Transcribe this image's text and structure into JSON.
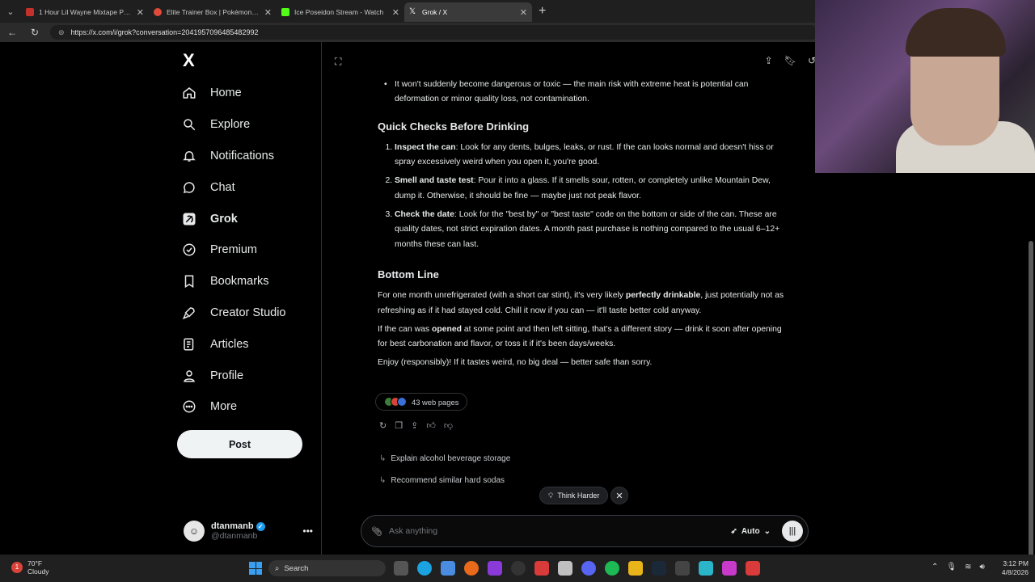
{
  "browser": {
    "tabs": [
      {
        "title": "1 Hour Lil Wayne Mixtape Prime",
        "favicon_color": "#c4302b",
        "active": false
      },
      {
        "title": "Elite Trainer Box | Pokémon Center",
        "favicon_color": "#e04a3a",
        "active": false
      },
      {
        "title": "Ice Poseidon Stream - Watch",
        "favicon_color": "#53fc18",
        "active": false
      },
      {
        "title": "Grok / X",
        "favicon_color": "#ffffff",
        "active": true
      }
    ],
    "url": "https://x.com/i/grok?conversation=2041957096485482992"
  },
  "sidebar": {
    "logo": "X",
    "items": [
      {
        "label": "Home",
        "icon": "home-icon"
      },
      {
        "label": "Explore",
        "icon": "search-icon"
      },
      {
        "label": "Notifications",
        "icon": "bell-icon"
      },
      {
        "label": "Chat",
        "icon": "chat-icon"
      },
      {
        "label": "Grok",
        "icon": "grok-icon",
        "active": true
      },
      {
        "label": "Premium",
        "icon": "premium-icon"
      },
      {
        "label": "Bookmarks",
        "icon": "bookmark-icon"
      },
      {
        "label": "Creator Studio",
        "icon": "rocket-icon"
      },
      {
        "label": "Articles",
        "icon": "article-icon"
      },
      {
        "label": "Profile",
        "icon": "person-icon"
      },
      {
        "label": "More",
        "icon": "more-icon"
      }
    ],
    "post_label": "Post",
    "user": {
      "name": "dtanmanb",
      "handle": "@dtanmanb"
    }
  },
  "response": {
    "bullet": "It won't suddenly become dangerous or toxic — the main risk with extreme heat is potential can deformation or minor quality loss, not contamination.",
    "section1_title": "Quick Checks Before Drinking",
    "checks": [
      {
        "bold": "Inspect the can",
        "text": ": Look for any dents, bulges, leaks, or rust. If the can looks normal and doesn't hiss or spray excessively weird when you open it, you're good."
      },
      {
        "bold": "Smell and taste test",
        "text": ": Pour it into a glass. If it smells sour, rotten, or completely unlike Mountain Dew, dump it. Otherwise, it should be fine — maybe just not peak flavor."
      },
      {
        "bold": "Check the date",
        "text": ": Look for the \"best by\" or \"best taste\" code on the bottom or side of the can. These are quality dates, not strict expiration dates. A month past purchase is nothing compared to the usual 6–12+ months these can last."
      }
    ],
    "section2_title": "Bottom Line",
    "p1_a": "For one month unrefrigerated (with a short car stint), it's very likely ",
    "p1_b": "perfectly drinkable",
    "p1_c": ", just potentially not as refreshing as if it had stayed cold. Chill it now if you can — it'll taste better cold anyway.",
    "p2_a": "If the can was ",
    "p2_b": "opened",
    "p2_c": " at some point and then left sitting, that's a different story — drink it soon after opening for best carbonation and flavor, or toss it if it's been days/weeks.",
    "p3": "Enjoy (responsibly)! If it tastes weird, no big deal — better safe than sorry."
  },
  "sources_label": "43 web pages",
  "followups": [
    "Explain alcohol beverage storage",
    "Recommend similar hard sodas"
  ],
  "think_label": "Think Harder",
  "composer": {
    "placeholder": "Ask anything",
    "mode": "Auto"
  },
  "taskbar": {
    "temp": "70°F",
    "condition": "Cloudy",
    "search_label": "Search",
    "time": "3:12 PM",
    "date": "4/8/2026"
  }
}
